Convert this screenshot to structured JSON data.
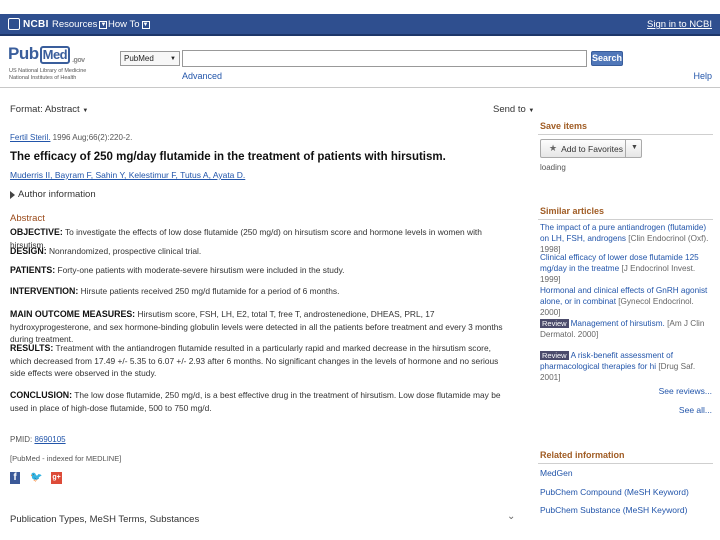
{
  "topbar": {
    "logo": "NCBI",
    "resources": "Resources",
    "howto": "How To",
    "signin": "Sign in to NCBI"
  },
  "header": {
    "logo_pub": "Pub",
    "logo_med": "Med",
    "logo_gov": ".gov",
    "sub_line1": "US National Library of Medicine",
    "sub_line2": "National Institutes of Health",
    "db_selected": "PubMed",
    "search_value": "",
    "search_button": "Search",
    "advanced": "Advanced",
    "help": "Help"
  },
  "toolbar": {
    "format": "Format: Abstract",
    "send_to": "Send to"
  },
  "article": {
    "journal": "Fertil Steril.",
    "citation": " 1996 Aug;66(2):220-2.",
    "title": "The efficacy of 250 mg/day flutamide in the treatment of patients with hirsutism.",
    "authors": "Muderris II, Bayram F, Sahin Y, Kelestimur F, Tutus A, Ayata D.",
    "author_info": "Author information",
    "abstract_heading": "Abstract",
    "sections": [
      {
        "label": "OBJECTIVE:",
        "text": " To investigate the effects of low dose flutamide (250 mg/d) on hirsutism score and hormone levels in women with hirsutism."
      },
      {
        "label": "DESIGN:",
        "text": " Nonrandomized, prospective clinical trial."
      },
      {
        "label": "PATIENTS:",
        "text": " Forty-one patients with moderate-severe hirsutism were included in the study."
      },
      {
        "label": "INTERVENTION:",
        "text": " Hirsute patients received 250 mg/d flutamide for a period of 6 months."
      },
      {
        "label": "MAIN OUTCOME MEASURES:",
        "text": " Hirsutism score, FSH, LH, E2, total T, free T, androstenedione, DHEAS, PRL, 17 hydroxyprogesterone, and sex hormone-binding globulin levels were detected in all the patients before treatment and every 3 months during treatment."
      },
      {
        "label": "RESULTS:",
        "text": " Treatment with the antiandrogen flutamide resulted in a particularly rapid and marked decrease in the hirsutism score, which decreased from 17.49 +/- 5.35 to 6.07 +/- 2.93 after 6 months. No significant changes in the levels of hormone and no serious side effects were observed in the study."
      },
      {
        "label": "CONCLUSION:",
        "text": " The low dose flutamide, 250 mg/d, is a best effective drug in the treatment of hirsutism. Low dose flutamide may be used in place of high-dose flutamide, 500 to 750 mg/d."
      }
    ],
    "pmid_label": "PMID: ",
    "pmid": "8690105",
    "indexed": "[PubMed - indexed for MEDLINE]",
    "pub_types": "Publication Types, MeSH Terms, Substances"
  },
  "sidebar": {
    "save_items": "Save items",
    "add_favorites": "Add to Favorites",
    "loading": "loading",
    "similar_heading": "Similar articles",
    "similar": [
      {
        "badge": "",
        "title": "The impact of a pure antiandrogen (flutamide) on LH, FSH, androgens ",
        "src": "[Clin Endocrinol (Oxf). 1998]"
      },
      {
        "badge": "",
        "title": "Clinical efficacy of lower dose flutamide 125 mg/day in the treatme ",
        "src": "[J Endocrinol Invest. 1999]"
      },
      {
        "badge": "",
        "title": "Hormonal and clinical effects of GnRH agonist alone, or in combinat ",
        "src": "[Gynecol Endocrinol. 2000]"
      },
      {
        "badge": "Review",
        "title": "Management of hirsutism. ",
        "src": "[Am J Clin Dermatol. 2000]"
      },
      {
        "badge": "Review",
        "title": "A risk-benefit assessment of pharmacological therapies for hi ",
        "src": "[Drug Saf. 2001]"
      }
    ],
    "see_reviews": "See reviews...",
    "see_all": "See all...",
    "related_heading": "Related information",
    "related": [
      "MedGen",
      "PubChem Compound (MeSH Keyword)",
      "PubChem Substance (MeSH Keyword)"
    ]
  }
}
